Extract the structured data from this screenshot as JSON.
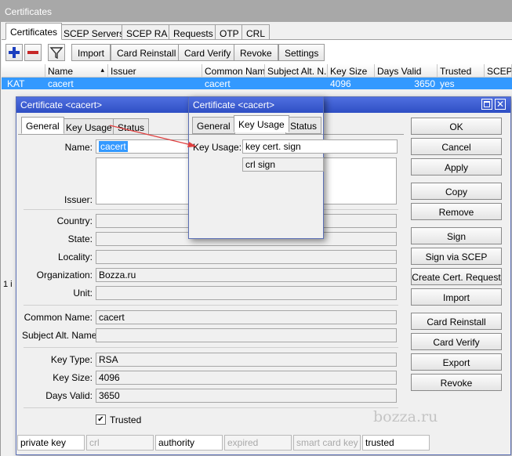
{
  "main": {
    "title": "Certificates",
    "tabs": [
      {
        "label": "Certificates"
      },
      {
        "label": "SCEP Servers"
      },
      {
        "label": "SCEP RA"
      },
      {
        "label": "Requests"
      },
      {
        "label": "OTP"
      },
      {
        "label": "CRL"
      }
    ],
    "toolbar": {
      "add_icon": "plus-icon",
      "remove_icon": "minus-icon",
      "filter_icon": "filter-icon",
      "import_label": "Import",
      "card_reinstall_label": "Card Reinstall",
      "card_verify_label": "Card Verify",
      "revoke_label": "Revoke",
      "settings_label": "Settings"
    },
    "table": {
      "columns": [
        "Name",
        "Issuer",
        "Common Name",
        "Subject Alt. N...",
        "Key Size",
        "Days Valid",
        "Trusted",
        "SCEP"
      ],
      "row": {
        "flag": "KAT",
        "name": "cacert",
        "issuer": "",
        "common_name": "cacert",
        "subject_alt": "",
        "key_size": "4096",
        "days_valid": "3650",
        "trusted": "yes",
        "scep": ""
      },
      "footer_fragment": "1 i"
    }
  },
  "dialog": {
    "title": "Certificate <cacert>",
    "tabs": [
      {
        "label": "General"
      },
      {
        "label": "Key Usage"
      },
      {
        "label": "Status"
      }
    ],
    "fields": {
      "name_label": "Name:",
      "name_value": "cacert",
      "issuer_label": "Issuer:",
      "country_label": "Country:",
      "state_label": "State:",
      "locality_label": "Locality:",
      "organization_label": "Organization:",
      "organization_value": "Bozza.ru",
      "unit_label": "Unit:",
      "common_name_label": "Common Name:",
      "common_name_value": "cacert",
      "subject_alt_label": "Subject Alt. Name:",
      "key_type_label": "Key Type:",
      "key_type_value": "RSA",
      "key_size_label": "Key Size:",
      "key_size_value": "4096",
      "days_valid_label": "Days Valid:",
      "days_valid_value": "3650",
      "trusted_label": "Trusted",
      "trusted_checked": "✔"
    },
    "buttons": {
      "ok": "OK",
      "cancel": "Cancel",
      "apply": "Apply",
      "copy": "Copy",
      "remove": "Remove",
      "sign": "Sign",
      "sign_via_scep": "Sign via SCEP",
      "create_cert_request": "Create Cert. Request",
      "import": "Import",
      "card_reinstall": "Card Reinstall",
      "card_verify": "Card Verify",
      "export": "Export",
      "revoke": "Revoke"
    },
    "status_bar": [
      "private key",
      "crl",
      "authority",
      "expired",
      "smart card key",
      "trusted"
    ]
  },
  "popup": {
    "title": "Certificate <cacert>",
    "tabs": [
      {
        "label": "General"
      },
      {
        "label": "Key Usage"
      },
      {
        "label": "Status"
      }
    ],
    "key_usage_label": "Key Usage:",
    "key_usage_values": [
      "key cert. sign",
      "crl sign"
    ]
  },
  "watermark": "bozza.ru",
  "colors": {
    "accent": "#3a5cd0",
    "selection": "#3399ff",
    "arrow": "#e04040"
  }
}
